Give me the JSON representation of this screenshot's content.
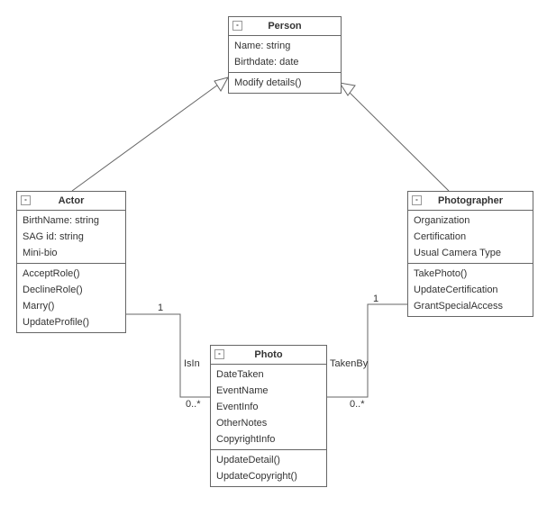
{
  "classes": {
    "person": {
      "name": "Person",
      "attributes": [
        "Name: string",
        "Birthdate: date"
      ],
      "operations": [
        "Modify details()"
      ]
    },
    "actor": {
      "name": "Actor",
      "attributes": [
        "BirthName: string",
        "SAG id: string",
        "Mini-bio"
      ],
      "operations": [
        "AcceptRole()",
        "DeclineRole()",
        "Marry()",
        "UpdateProfile()"
      ]
    },
    "photographer": {
      "name": "Photographer",
      "attributes": [
        "Organization",
        "Certification",
        "Usual Camera Type"
      ],
      "operations": [
        "TakePhoto()",
        "UpdateCertification",
        "GrantSpecialAccess"
      ]
    },
    "photo": {
      "name": "Photo",
      "attributes": [
        "DateTaken",
        "EventName",
        "EventInfo",
        "OtherNotes",
        "CopyrightInfo"
      ],
      "operations": [
        "UpdateDetail()",
        "UpdateCopyright()"
      ]
    }
  },
  "associations": {
    "isin": {
      "label": "IsIn",
      "mult_actor": "1",
      "mult_photo": "0..*"
    },
    "takenby": {
      "label": "TakenBy",
      "mult_photographer": "1",
      "mult_photo": "0..*"
    }
  }
}
